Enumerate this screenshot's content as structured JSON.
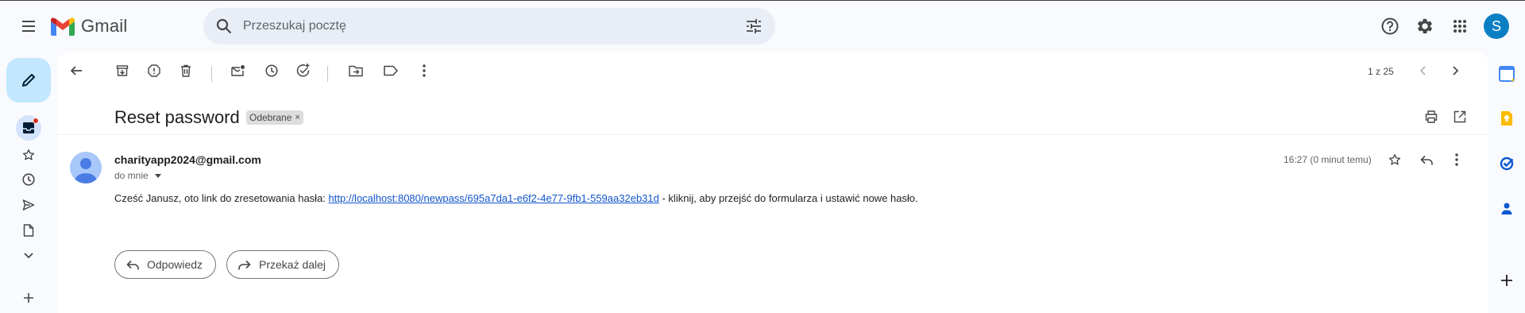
{
  "app": {
    "name": "Gmail",
    "avatar_letter": "S"
  },
  "search": {
    "placeholder": "Przeszukaj pocztę"
  },
  "toolbar": {
    "pager_text": "1 z 25"
  },
  "message": {
    "subject": "Reset password",
    "label": "Odebrane",
    "label_remove": "×",
    "sender": "charityapp2024@gmail.com",
    "to_line": "do mnie",
    "time": "16:27 (0 minut temu)",
    "body_before": "Cześć Janusz, oto link do zresetowania hasła: ",
    "link": "http://localhost:8080/newpass/695a7da1-e6f2-4e77-9fb1-559aa32eb31d",
    "body_after": " - kliknij, aby przejść do formularza i ustawić nowe hasło."
  },
  "actions": {
    "reply": "Odpowiedz",
    "forward": "Przekaż dalej"
  },
  "colors": {
    "accent": "#0b57d0",
    "compose_bg": "#c2e7ff",
    "avatar_bg": "#0b7fc4",
    "unread_dot": "#d93025"
  },
  "icons": {
    "menu": "menu-icon",
    "search": "search-icon",
    "filter": "tune-icon",
    "help": "help-icon",
    "settings": "gear-icon",
    "apps": "apps-grid-icon"
  }
}
